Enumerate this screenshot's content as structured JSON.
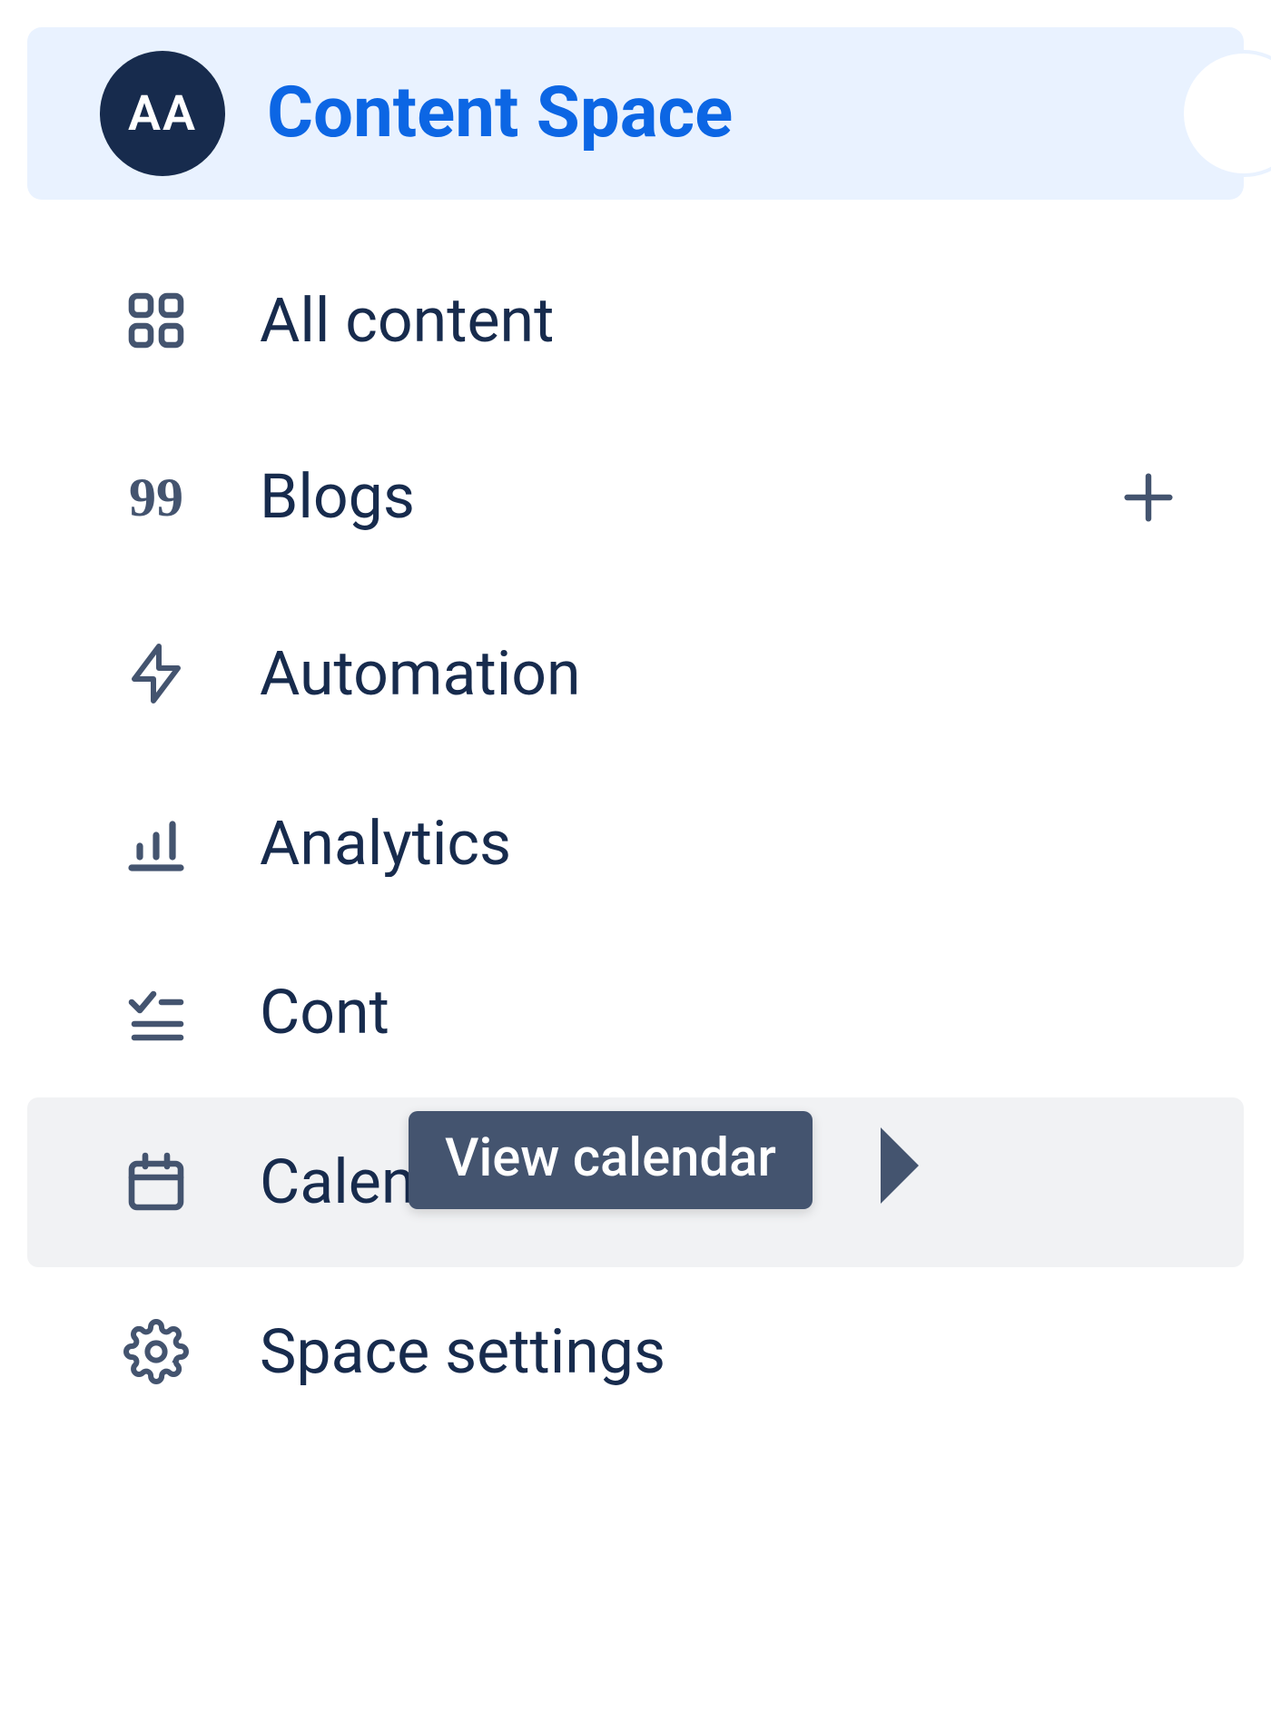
{
  "space": {
    "avatar_initials": "AA",
    "title": "Content Space"
  },
  "nav": {
    "all_content": "All content",
    "blogs": "Blogs",
    "automation": "Automation",
    "analytics": "Analytics",
    "content_manager": "Cont",
    "calendars": "Calendars",
    "space_settings": "Space settings"
  },
  "tooltip": {
    "view_calendar": "View calendar"
  }
}
